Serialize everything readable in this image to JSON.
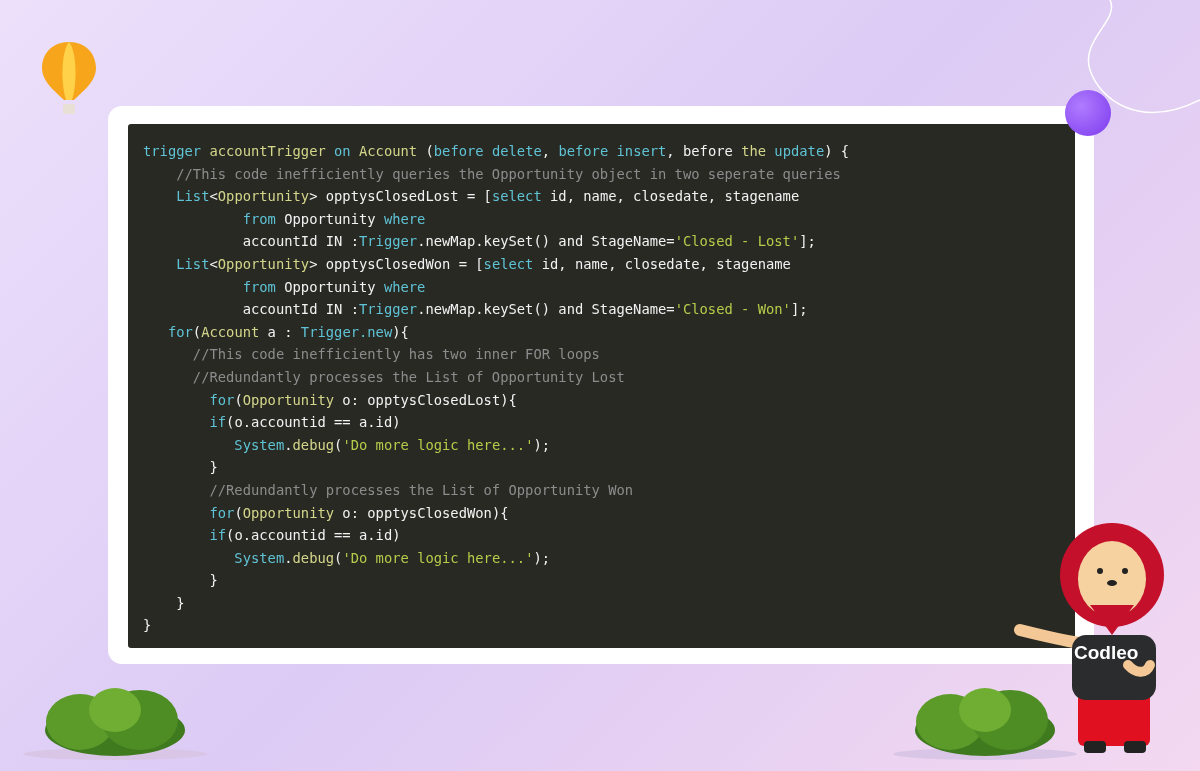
{
  "code_lines": [
    {
      "tokens": [
        {
          "text": "trigger ",
          "kind": "keyword"
        },
        {
          "text": "accountTrigger ",
          "kind": "type"
        },
        {
          "text": "on ",
          "kind": "keyword"
        },
        {
          "text": "Account",
          "kind": "type"
        },
        {
          "text": " (",
          "kind": "plain"
        },
        {
          "text": "before delete",
          "kind": "keyword"
        },
        {
          "text": ", ",
          "kind": "plain"
        },
        {
          "text": "before insert",
          "kind": "keyword"
        },
        {
          "text": ", before ",
          "kind": "plain"
        },
        {
          "text": "the ",
          "kind": "type"
        },
        {
          "text": "update",
          "kind": "keyword"
        },
        {
          "text": ") {",
          "kind": "plain"
        }
      ]
    },
    {
      "tokens": [
        {
          "text": "    //This code inefficiently queries the Opportunity object in two seperate queries",
          "kind": "comment"
        }
      ]
    },
    {
      "tokens": [
        {
          "text": "    List",
          "kind": "keyword"
        },
        {
          "text": "<",
          "kind": "plain"
        },
        {
          "text": "Opportunity",
          "kind": "type"
        },
        {
          "text": "> opptysClosedLost = [",
          "kind": "plain"
        },
        {
          "text": "select",
          "kind": "keyword"
        },
        {
          "text": " id, name, closedate, stagename",
          "kind": "plain"
        }
      ]
    },
    {
      "tokens": [
        {
          "text": "            from",
          "kind": "keyword"
        },
        {
          "text": " Opportunity ",
          "kind": "plain"
        },
        {
          "text": "where",
          "kind": "keyword"
        }
      ]
    },
    {
      "tokens": [
        {
          "text": "            accountId IN :",
          "kind": "plain"
        },
        {
          "text": "Trigger",
          "kind": "keyword"
        },
        {
          "text": ".newMap.keySet() and StageName=",
          "kind": "plain"
        },
        {
          "text": "'Closed - Lost'",
          "kind": "string"
        },
        {
          "text": "];",
          "kind": "plain"
        }
      ]
    },
    {
      "tokens": [
        {
          "text": "    List",
          "kind": "keyword"
        },
        {
          "text": "<",
          "kind": "plain"
        },
        {
          "text": "Opportunity",
          "kind": "type"
        },
        {
          "text": "> opptysClosedWon = [",
          "kind": "plain"
        },
        {
          "text": "select",
          "kind": "keyword"
        },
        {
          "text": " id, name, closedate, stagename",
          "kind": "plain"
        }
      ]
    },
    {
      "tokens": [
        {
          "text": "            from",
          "kind": "keyword"
        },
        {
          "text": " Opportunity ",
          "kind": "plain"
        },
        {
          "text": "where",
          "kind": "keyword"
        }
      ]
    },
    {
      "tokens": [
        {
          "text": "            accountId IN :",
          "kind": "plain"
        },
        {
          "text": "Trigger",
          "kind": "keyword"
        },
        {
          "text": ".newMap.keySet() and StageName=",
          "kind": "plain"
        },
        {
          "text": "'Closed - Won'",
          "kind": "string"
        },
        {
          "text": "];",
          "kind": "plain"
        }
      ]
    },
    {
      "tokens": [
        {
          "text": "   for",
          "kind": "keyword"
        },
        {
          "text": "(",
          "kind": "plain"
        },
        {
          "text": "Account",
          "kind": "type"
        },
        {
          "text": " a : ",
          "kind": "plain"
        },
        {
          "text": "Trigger.new",
          "kind": "keyword"
        },
        {
          "text": "){",
          "kind": "plain"
        }
      ]
    },
    {
      "tokens": [
        {
          "text": "      //This code inefficiently has two inner FOR loops",
          "kind": "comment"
        }
      ]
    },
    {
      "tokens": [
        {
          "text": "      //Redundantly processes the List of Opportunity Lost",
          "kind": "comment"
        }
      ]
    },
    {
      "tokens": [
        {
          "text": "        for",
          "kind": "keyword"
        },
        {
          "text": "(",
          "kind": "plain"
        },
        {
          "text": "Opportunity",
          "kind": "type"
        },
        {
          "text": " o: opptysClosedLost){",
          "kind": "plain"
        }
      ]
    },
    {
      "tokens": [
        {
          "text": "        if",
          "kind": "keyword"
        },
        {
          "text": "(o.accountid == a.id)",
          "kind": "plain"
        }
      ]
    },
    {
      "tokens": [
        {
          "text": "           System",
          "kind": "keyword"
        },
        {
          "text": ".",
          "kind": "plain"
        },
        {
          "text": "debug",
          "kind": "type"
        },
        {
          "text": "(",
          "kind": "plain"
        },
        {
          "text": "'Do more logic here...'",
          "kind": "string"
        },
        {
          "text": ");",
          "kind": "plain"
        }
      ]
    },
    {
      "tokens": [
        {
          "text": "        }",
          "kind": "plain"
        }
      ]
    },
    {
      "tokens": [
        {
          "text": "        //Redundantly processes the List of Opportunity Won",
          "kind": "comment"
        }
      ]
    },
    {
      "tokens": [
        {
          "text": "        for",
          "kind": "keyword"
        },
        {
          "text": "(",
          "kind": "plain"
        },
        {
          "text": "Opportunity",
          "kind": "type"
        },
        {
          "text": " o: opptysClosedWon){",
          "kind": "plain"
        }
      ]
    },
    {
      "tokens": [
        {
          "text": "        if",
          "kind": "keyword"
        },
        {
          "text": "(o.accountid == a.id)",
          "kind": "plain"
        }
      ]
    },
    {
      "tokens": [
        {
          "text": "           System",
          "kind": "keyword"
        },
        {
          "text": ".",
          "kind": "plain"
        },
        {
          "text": "debug",
          "kind": "type"
        },
        {
          "text": "(",
          "kind": "plain"
        },
        {
          "text": "'Do more logic here...'",
          "kind": "string"
        },
        {
          "text": ");",
          "kind": "plain"
        }
      ]
    },
    {
      "tokens": [
        {
          "text": "        }",
          "kind": "plain"
        }
      ]
    },
    {
      "tokens": [
        {
          "text": "    }",
          "kind": "plain"
        }
      ]
    },
    {
      "tokens": [
        {
          "text": "}",
          "kind": "plain"
        }
      ]
    }
  ],
  "mascot": {
    "shirt_text": "Codleo"
  }
}
